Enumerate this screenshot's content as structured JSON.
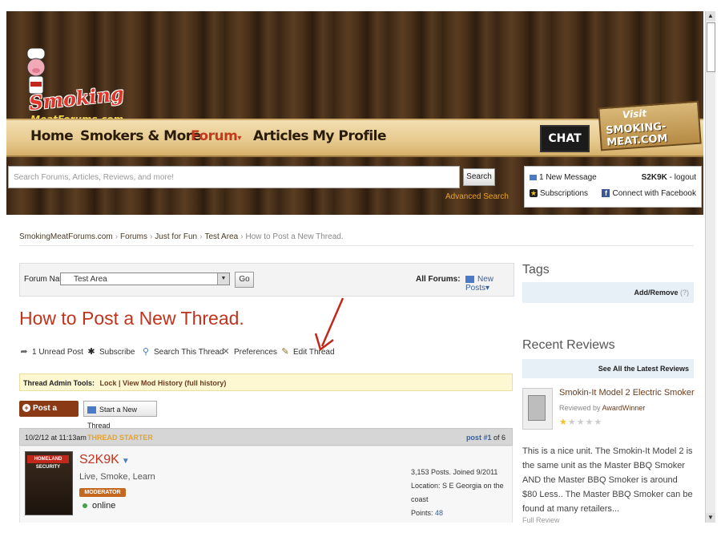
{
  "header": {
    "logo_text": "Smoking",
    "logo_sub": "MeatForums.com",
    "nav": [
      "Home",
      "Smokers & More",
      "Forum",
      "Articles",
      "My Profile"
    ],
    "forum_caret": "▾",
    "chat_label": "CHAT",
    "visit_line1": "Visit",
    "visit_line2": "SMOKING-MEAT.COM",
    "search_placeholder": "Search Forums, Articles, Reviews, and more!",
    "search_button": "Search",
    "advanced_search": "Advanced Search",
    "new_message": "1 New Message",
    "subscriptions": "Subscriptions",
    "user": "S2K9K",
    "logout": "logout",
    "connect_fb": "Connect with Facebook"
  },
  "breadcrumb": [
    "SmokingMeatForums.com",
    "Forums",
    "Just for Fun",
    "Test Area",
    "How to Post a New Thread."
  ],
  "forumnav": {
    "label": "Forum Nav:",
    "selected": "Test Area",
    "go": "Go",
    "all_forums": "All Forums:",
    "new_posts": "New Posts▾"
  },
  "thread": {
    "title": "How to Post a New Thread.",
    "actions": [
      "1 Unread Post",
      "Subscribe",
      "Search This Thread",
      "Preferences",
      "Edit Thread"
    ],
    "admin_label": "Thread Admin Tools:",
    "admin_links": "Lock | View Mod History (full history)",
    "post_reply": "Post a Reply",
    "start_thread": "Start a New Thread"
  },
  "post": {
    "date": "10/2/12 at 11:13am",
    "starter": "THREAD STARTER",
    "post_label": "post",
    "post_num": "#1",
    "post_of": "of 6",
    "username": "S2K9K",
    "user_title": "Live, Smoke, Learn",
    "badge": "MODERATOR",
    "status": "online",
    "avatar_label": "HOMELAND SECURITY",
    "posts_joined": "3,153 Posts. Joined 9/2011",
    "location": "Location: S E Georgia on the coast",
    "points_label": "Points:",
    "points": "48"
  },
  "sidebar": {
    "tags_heading": "Tags",
    "tags_add_remove": "Add/Remove",
    "tags_help": "(?)",
    "reviews_heading": "Recent Reviews",
    "see_all": "See All the Latest Reviews",
    "review_title": "Smokin-It Model 2 Electric Smoker",
    "reviewed_by": "Reviewed by",
    "reviewer": "AwardWinner",
    "rating": 1,
    "review_text": "This is a nice unit.  The Smokin-It Model 2 is the same unit as the Master BBQ Smoker AND the Master BBQ Smoker is around $80 Less..  The Master BBQ Smoker can be found at many retailers...",
    "edit_partial": "Full Review"
  },
  "colors": {
    "accent": "#c0341e",
    "link_blue": "#3a5f9c",
    "starter_orange": "#e6a22c",
    "reply_brown": "#8a3b16"
  }
}
